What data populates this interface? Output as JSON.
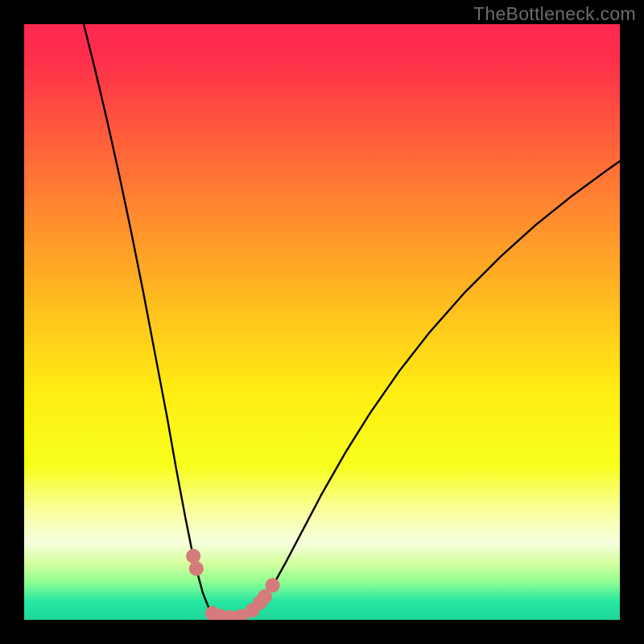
{
  "watermark": "TheBottleneck.com",
  "colors": {
    "frame": "#000000",
    "gradient_stops": [
      {
        "offset": 0.0,
        "color": "#ff2850"
      },
      {
        "offset": 0.06,
        "color": "#ff2f4b"
      },
      {
        "offset": 0.18,
        "color": "#ff5a3c"
      },
      {
        "offset": 0.33,
        "color": "#ff8e2e"
      },
      {
        "offset": 0.48,
        "color": "#ffc11e"
      },
      {
        "offset": 0.62,
        "color": "#ffee12"
      },
      {
        "offset": 0.74,
        "color": "#f7ff1a"
      },
      {
        "offset": 0.82,
        "color": "#f9ffa2"
      },
      {
        "offset": 0.87,
        "color": "#f6ffde"
      },
      {
        "offset": 0.905,
        "color": "#d6ff9e"
      },
      {
        "offset": 0.935,
        "color": "#92ff92"
      },
      {
        "offset": 0.97,
        "color": "#24e7a1"
      },
      {
        "offset": 1.0,
        "color": "#1fd69b"
      }
    ],
    "curve": "#000000",
    "marker_fill": "#d67b7b",
    "marker_stroke": "#b55c5c"
  },
  "chart_data": {
    "type": "line",
    "title": "",
    "xlabel": "",
    "ylabel": "",
    "xlim": [
      0,
      100
    ],
    "ylim": [
      0,
      100
    ],
    "series": [
      {
        "name": "bottleneck-curve",
        "points": [
          {
            "x": 10.0,
            "y": 100.0
          },
          {
            "x": 12.0,
            "y": 92.0
          },
          {
            "x": 14.0,
            "y": 83.5
          },
          {
            "x": 16.0,
            "y": 74.5
          },
          {
            "x": 18.0,
            "y": 65.0
          },
          {
            "x": 20.0,
            "y": 55.0
          },
          {
            "x": 22.0,
            "y": 44.5
          },
          {
            "x": 24.0,
            "y": 34.0
          },
          {
            "x": 25.5,
            "y": 25.5
          },
          {
            "x": 27.0,
            "y": 17.5
          },
          {
            "x": 28.5,
            "y": 10.0
          },
          {
            "x": 30.0,
            "y": 4.5
          },
          {
            "x": 31.0,
            "y": 2.0
          },
          {
            "x": 32.5,
            "y": 0.8
          },
          {
            "x": 34.0,
            "y": 0.4
          },
          {
            "x": 35.5,
            "y": 0.4
          },
          {
            "x": 37.0,
            "y": 0.8
          },
          {
            "x": 38.5,
            "y": 1.8
          },
          {
            "x": 40.0,
            "y": 3.4
          },
          {
            "x": 42.0,
            "y": 6.2
          },
          {
            "x": 44.0,
            "y": 9.8
          },
          {
            "x": 47.0,
            "y": 15.5
          },
          {
            "x": 50.0,
            "y": 21.2
          },
          {
            "x": 54.0,
            "y": 28.2
          },
          {
            "x": 58.0,
            "y": 34.6
          },
          {
            "x": 63.0,
            "y": 41.8
          },
          {
            "x": 68.0,
            "y": 48.2
          },
          {
            "x": 74.0,
            "y": 55.0
          },
          {
            "x": 80.0,
            "y": 61.0
          },
          {
            "x": 86.0,
            "y": 66.4
          },
          {
            "x": 92.0,
            "y": 71.2
          },
          {
            "x": 98.0,
            "y": 75.6
          },
          {
            "x": 100.0,
            "y": 77.0
          }
        ]
      }
    ],
    "markers": [
      {
        "x": 28.4,
        "y": 10.7
      },
      {
        "x": 28.9,
        "y": 8.6
      },
      {
        "x": 31.6,
        "y": 1.1
      },
      {
        "x": 33.0,
        "y": 0.6
      },
      {
        "x": 34.6,
        "y": 0.4
      },
      {
        "x": 36.4,
        "y": 0.6
      },
      {
        "x": 38.3,
        "y": 1.6
      },
      {
        "x": 39.6,
        "y": 2.9
      },
      {
        "x": 40.4,
        "y": 3.9
      },
      {
        "x": 41.7,
        "y": 5.8
      }
    ],
    "marker_radius_px": 9
  }
}
